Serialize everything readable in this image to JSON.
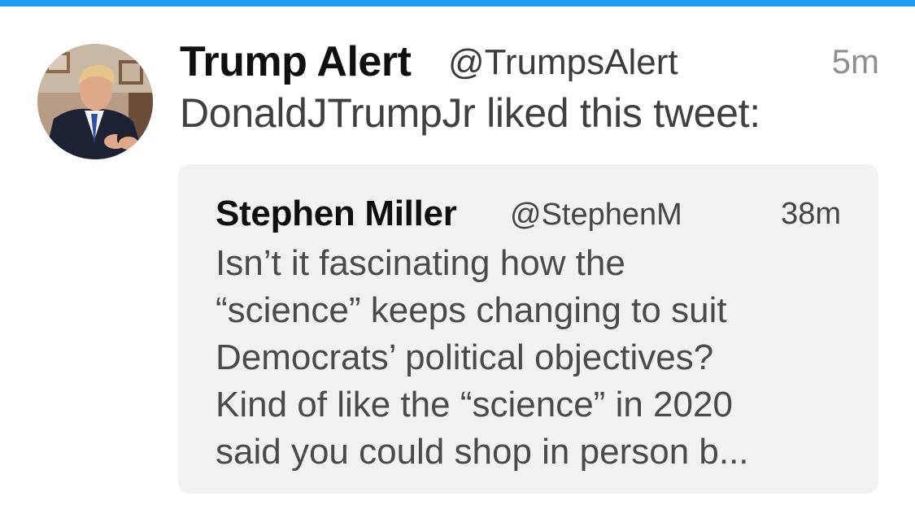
{
  "tweet": {
    "display_name": "Trump Alert",
    "handle": "@TrumpsAlert",
    "time": "5m",
    "action_text": "DonaldJTrumpJr liked this tweet:",
    "avatar_icon": "profile-photo",
    "accent_color": "#1d9bf0"
  },
  "quoted": {
    "display_name": "Stephen Miller",
    "handle": "@StephenM",
    "time": "38m",
    "lines": [
      "Isn’t it fascinating how the",
      "“science” keeps changing to suit",
      "Democrats’ political objectives?",
      "Kind of like the “science” in 2020",
      "said you could shop in person b..."
    ]
  }
}
